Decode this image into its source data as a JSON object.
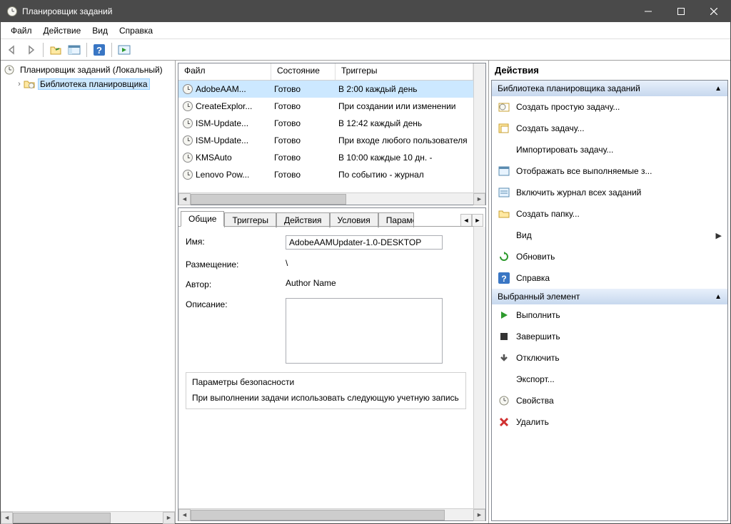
{
  "window": {
    "title": "Планировщик заданий"
  },
  "menu": {
    "file": "Файл",
    "action": "Действие",
    "view": "Вид",
    "help": "Справка"
  },
  "tree": {
    "root": "Планировщик заданий (Локальный)",
    "library": "Библиотека планировщика"
  },
  "columns": {
    "file": "Файл",
    "state": "Состояние",
    "triggers": "Триггеры"
  },
  "tasks": [
    {
      "name": "AdobeAAM...",
      "state": "Готово",
      "trigger": "В 2:00 каждый день"
    },
    {
      "name": "CreateExplor...",
      "state": "Готово",
      "trigger": "При создании или изменении"
    },
    {
      "name": "ISM-Update...",
      "state": "Готово",
      "trigger": "В 12:42 каждый день"
    },
    {
      "name": "ISM-Update...",
      "state": "Готово",
      "trigger": "При входе любого пользователя"
    },
    {
      "name": "KMSAuto",
      "state": "Готово",
      "trigger": "В 10:00 каждые 10 дн. - "
    },
    {
      "name": "Lenovo Pow...",
      "state": "Готово",
      "trigger": "По событию - журнал"
    }
  ],
  "details": {
    "tabs": {
      "general": "Общие",
      "triggers": "Триггеры",
      "actions": "Действия",
      "conditions": "Условия",
      "params": "Параметры"
    },
    "labels": {
      "name": "Имя:",
      "location": "Размещение:",
      "author": "Автор:",
      "description": "Описание:"
    },
    "values": {
      "name": "AdobeAAMUpdater-1.0-DESKTOP",
      "location": "\\",
      "author": "Author Name"
    },
    "security": {
      "title": "Параметры безопасности",
      "text": "При выполнении задачи использовать следующую учетную запись"
    }
  },
  "actions": {
    "title": "Действия",
    "section_library": "Библиотека планировщика заданий",
    "section_selected": "Выбранный элемент",
    "items_lib": {
      "create_basic": "Создать простую задачу...",
      "create": "Создать задачу...",
      "import": "Импортировать задачу...",
      "show_running": "Отображать все выполняемые з...",
      "enable_history": "Включить журнал всех заданий",
      "new_folder": "Создать папку...",
      "view": "Вид",
      "refresh": "Обновить",
      "help": "Справка"
    },
    "items_sel": {
      "run": "Выполнить",
      "end": "Завершить",
      "disable": "Отключить",
      "export": "Экспорт...",
      "properties": "Свойства",
      "delete": "Удалить"
    }
  }
}
